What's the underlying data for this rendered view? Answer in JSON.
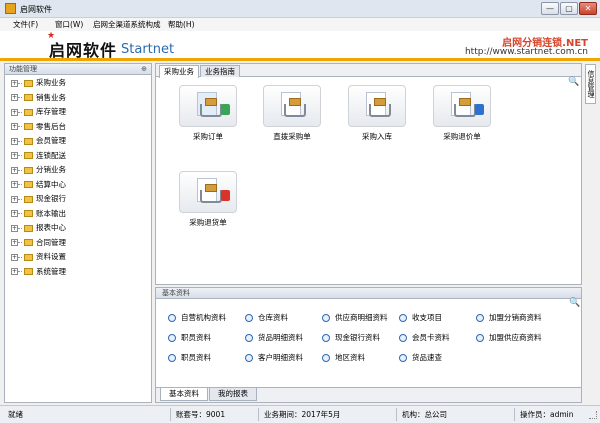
{
  "window": {
    "title": "启网软件",
    "minimize": "—",
    "maximize": "▢",
    "close": "✕"
  },
  "menu": [
    "文件(F)",
    "窗口(W)",
    "启网全渠道系统构成",
    "帮助(H)"
  ],
  "banner": {
    "logo_cn": "启网软件",
    "logo_en": "Startnet",
    "brand_cn": "启网分销连锁.NET",
    "brand_url": "http://www.startnet.com.cn"
  },
  "left_panel": {
    "title": "功能管理",
    "items": [
      "采购业务",
      "销售业务",
      "库存管理",
      "零售后台",
      "会员管理",
      "连锁配送",
      "分销业务",
      "结算中心",
      "现金银行",
      "账本输出",
      "报表中心",
      "合同管理",
      "资料设置",
      "系统管理"
    ]
  },
  "main": {
    "tabs": [
      "采购业务",
      "业务指南"
    ],
    "tiles": [
      "采购订单",
      "直拨采购单",
      "采购入库",
      "采购退价单",
      "采购退货单"
    ]
  },
  "right_tab": "信息管理",
  "basic": {
    "title": "基本资料",
    "links": [
      "自营机构资料",
      "仓库资料",
      "供应商明细资料",
      "收支项目",
      "加盟分销商资料",
      "职员资料",
      "货品明细资料",
      "现金银行资料",
      "会员卡资料",
      "加盟供应商资料",
      "职员资料",
      "客户明细资料",
      "地区资料",
      "货品速查"
    ],
    "tabs": [
      "基本资料",
      "我的报表"
    ]
  },
  "status": {
    "state": "就绪",
    "account": "账套号：9001",
    "period": "业务期间：2017年5月",
    "org": "机构：总公司",
    "operator": "操作员：admin"
  },
  "colors": {
    "accent": "#f0a600",
    "brand": "#d6442a",
    "link_icon": "#2d68b3"
  }
}
